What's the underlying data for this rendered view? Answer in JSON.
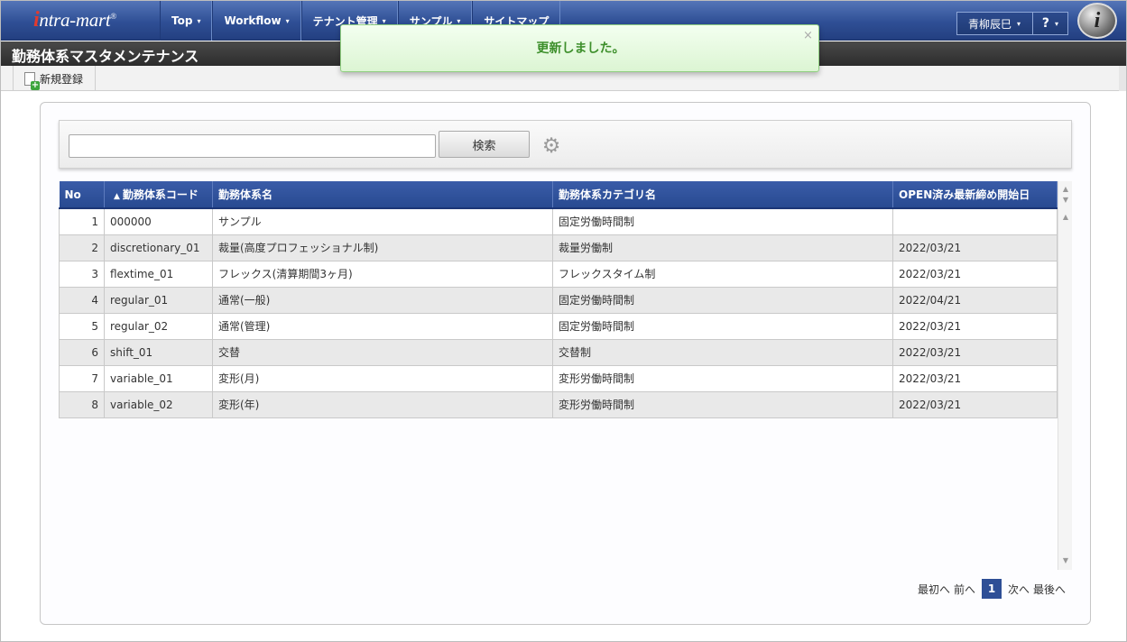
{
  "header": {
    "logo_prefix": "i",
    "logo_text": "ntra-mart",
    "logo_mark": "®",
    "nav": [
      {
        "label": "Top"
      },
      {
        "label": "Workflow"
      },
      {
        "label": "テナント管理"
      },
      {
        "label": "サンプル"
      },
      {
        "label": "サイトマップ"
      }
    ],
    "caret_icon": "▾",
    "user_name": "青柳辰巳",
    "help_label": "?",
    "brand_badge": "i"
  },
  "page": {
    "title": "勤務体系マスタメンテナンス"
  },
  "toolbar": {
    "new_label": "新規登録"
  },
  "toast": {
    "message": "更新しました。",
    "close_label": "×"
  },
  "search": {
    "value": "",
    "button_label": "検索",
    "settings_glyph": "⚙"
  },
  "grid": {
    "sort_indicator": "▲",
    "columns": [
      "No",
      "勤務体系コード",
      "勤務体系名",
      "勤務体系カテゴリ名",
      "OPEN済み最新締め開始日"
    ],
    "rows": [
      {
        "no": "1",
        "code": "000000",
        "name": "サンプル",
        "category": "固定労働時間制",
        "date": ""
      },
      {
        "no": "2",
        "code": "discretionary_01",
        "name": "裁量(高度プロフェッショナル制)",
        "category": "裁量労働制",
        "date": "2022/03/21"
      },
      {
        "no": "3",
        "code": "flextime_01",
        "name": "フレックス(清算期間3ヶ月)",
        "category": "フレックスタイム制",
        "date": "2022/03/21"
      },
      {
        "no": "4",
        "code": "regular_01",
        "name": "通常(一般)",
        "category": "固定労働時間制",
        "date": "2022/04/21"
      },
      {
        "no": "5",
        "code": "regular_02",
        "name": "通常(管理)",
        "category": "固定労働時間制",
        "date": "2022/03/21"
      },
      {
        "no": "6",
        "code": "shift_01",
        "name": "交替",
        "category": "交替制",
        "date": "2022/03/21"
      },
      {
        "no": "7",
        "code": "variable_01",
        "name": "変形(月)",
        "category": "変形労働時間制",
        "date": "2022/03/21"
      },
      {
        "no": "8",
        "code": "variable_02",
        "name": "変形(年)",
        "category": "変形労働時間制",
        "date": "2022/03/21"
      }
    ]
  },
  "pager": {
    "first_label": "最初へ",
    "prev_label": "前へ",
    "current_page": "1",
    "next_label": "次へ",
    "last_label": "最後へ"
  },
  "colors": {
    "nav_blue": "#2f4f95",
    "grid_header": "#2e4f96",
    "toast_text": "#3d8f2b",
    "row_alt": "#e9e9e9"
  }
}
